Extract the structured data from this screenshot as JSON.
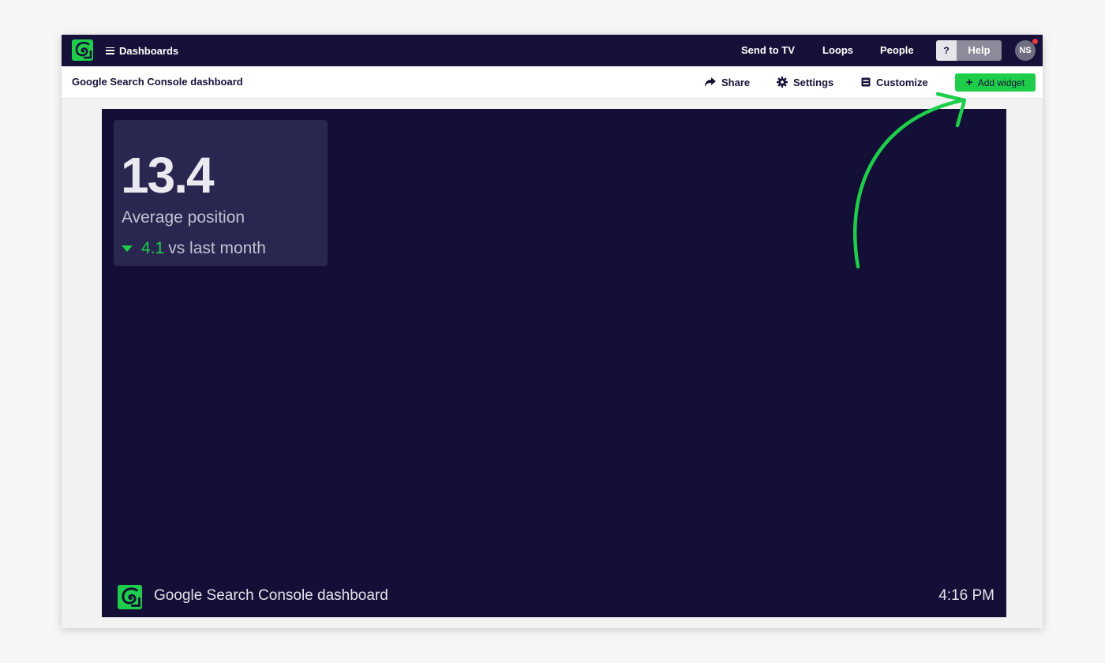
{
  "topbar": {
    "menu_label": "Dashboards",
    "nav": [
      "Send to TV",
      "Loops",
      "People"
    ],
    "help_icon": "?",
    "help_label": "Help",
    "avatar_initials": "NS"
  },
  "subbar": {
    "title": "Google Search Console dashboard",
    "share_label": "Share",
    "settings_label": "Settings",
    "customize_label": "Customize",
    "add_widget_label": "Add widget"
  },
  "widget": {
    "value": "13.4",
    "label": "Average position",
    "change_value": "4.1",
    "change_text": "vs last month"
  },
  "footer": {
    "title": "Google Search Console dashboard",
    "time": "4:16 PM"
  },
  "colors": {
    "navy": "#161138",
    "canvas": "#140f36",
    "widget_bg": "#29274f",
    "accent_green": "#1ece4a",
    "notification_red": "#e53a3a"
  },
  "icons": {
    "logo": "geckoboard-logo-icon",
    "menu": "hamburger-icon",
    "share": "share-arrow-icon",
    "settings": "gear-icon",
    "customize": "customize-icon",
    "add": "plus-icon",
    "trend": "down-triangle-icon"
  }
}
